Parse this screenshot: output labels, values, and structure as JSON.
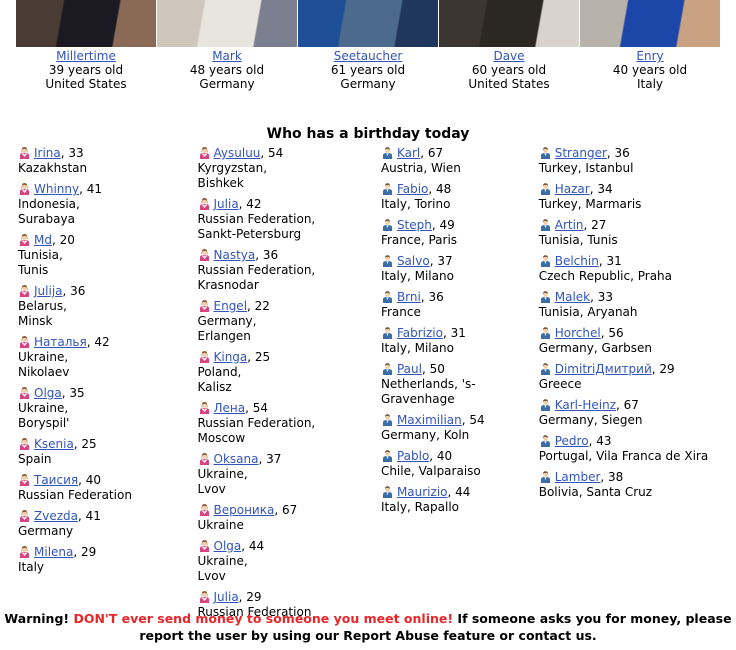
{
  "featured": {
    "members": [
      {
        "name": "Millertime",
        "age": "39 years old",
        "country": "United States",
        "photo_tone": [
          "#4a3b34",
          "#1b1a22",
          "#8a6a55"
        ]
      },
      {
        "name": "Mark",
        "age": "48 years old",
        "country": "Germany",
        "photo_tone": [
          "#cfc6bc",
          "#e8e4de",
          "#7b7f90"
        ]
      },
      {
        "name": "Seetaucher",
        "age": "61 years old",
        "country": "Germany",
        "photo_tone": [
          "#1e4f96",
          "#4b6a8d",
          "#21365c"
        ]
      },
      {
        "name": "Dave",
        "age": "60 years old",
        "country": "United States",
        "photo_tone": [
          "#3c3632",
          "#2b2723",
          "#d8d3cc"
        ]
      },
      {
        "name": "Enry",
        "age": "40 years old",
        "country": "Italy",
        "photo_tone": [
          "#b7b3aa",
          "#1c47a8",
          "#c9a283"
        ]
      }
    ]
  },
  "heading": "Who has a birthday today",
  "icons": {
    "female": "female-user-icon",
    "male": "male-user-icon"
  },
  "colors": {
    "link": "#3355bb",
    "warning_red": "#e8262a",
    "female_icon": "#d9437f",
    "male_icon": "#3a6ea5"
  },
  "columns": [
    {
      "gender": "female",
      "entries": [
        {
          "name": "Irina",
          "age": "33",
          "location": "Kazakhstan"
        },
        {
          "name": "Whinny",
          "age": "41",
          "location": "Indonesia,\nSurabaya"
        },
        {
          "name": "Md",
          "age": "20",
          "location": "Tunisia,\nTunis"
        },
        {
          "name": "Julija",
          "age": "36",
          "location": "Belarus,\nMinsk"
        },
        {
          "name": "Наталья",
          "age": "42",
          "location": "Ukraine,\nNikolaev"
        },
        {
          "name": "Olga",
          "age": "35",
          "location": "Ukraine,\nBoryspil'"
        },
        {
          "name": "Ksenia",
          "age": "25",
          "location": "Spain"
        },
        {
          "name": "Таисия",
          "age": "40",
          "location": "Russian Federation"
        },
        {
          "name": "Zvezda",
          "age": "41",
          "location": "Germany"
        },
        {
          "name": "Milena",
          "age": "29",
          "location": "Italy"
        }
      ]
    },
    {
      "gender": "female",
      "entries": [
        {
          "name": "Aysuluu",
          "age": "54",
          "location": "Kyrgyzstan,\nBishkek"
        },
        {
          "name": "Julia",
          "age": "42",
          "location": "Russian Federation,\nSankt-Petersburg"
        },
        {
          "name": "Nastya",
          "age": "36",
          "location": "Russian Federation,\nKrasnodar"
        },
        {
          "name": "Engel",
          "age": "22",
          "location": "Germany,\nErlangen"
        },
        {
          "name": "Kinga",
          "age": "25",
          "location": "Poland,\nKalisz"
        },
        {
          "name": "Лена",
          "age": "54",
          "location": "Russian Federation,\nMoscow"
        },
        {
          "name": "Oksana",
          "age": "37",
          "location": "Ukraine,\nLvov"
        },
        {
          "name": "Вероника",
          "age": "67",
          "location": "Ukraine"
        },
        {
          "name": "Olga",
          "age": "44",
          "location": "Ukraine,\nLvov"
        },
        {
          "name": "Julia",
          "age": "29",
          "location": "Russian Federation"
        }
      ]
    },
    {
      "gender": "male",
      "entries": [
        {
          "name": "Karl",
          "age": "67",
          "location": "Austria, Wien"
        },
        {
          "name": "Fabio",
          "age": "48",
          "location": "Italy, Torino"
        },
        {
          "name": "Steph",
          "age": "49",
          "location": "France, Paris"
        },
        {
          "name": "Salvo",
          "age": "37",
          "location": "Italy, Milano"
        },
        {
          "name": "Brni",
          "age": "36",
          "location": "France"
        },
        {
          "name": "Fabrizio",
          "age": "31",
          "location": "Italy, Milano"
        },
        {
          "name": "Paul",
          "age": "50",
          "location": "Netherlands, 's-Gravenhage"
        },
        {
          "name": "Maximilian",
          "age": "54",
          "location": "Germany, Koln"
        },
        {
          "name": "Pablo",
          "age": "40",
          "location": "Chile, Valparaiso"
        },
        {
          "name": "Maurizio",
          "age": "44",
          "location": "Italy, Rapallo"
        }
      ]
    },
    {
      "gender": "male",
      "entries": [
        {
          "name": "Stranger",
          "age": "36",
          "location": "Turkey, Istanbul"
        },
        {
          "name": "Hazar",
          "age": "34",
          "location": "Turkey, Marmaris"
        },
        {
          "name": "Artin",
          "age": "27",
          "location": "Tunisia, Tunis"
        },
        {
          "name": "Belchin",
          "age": "31",
          "location": "Czech Republic, Praha"
        },
        {
          "name": "Malek",
          "age": "33",
          "location": "Tunisia, Aryanah"
        },
        {
          "name": "Horchel",
          "age": "56",
          "location": "Germany, Garbsen"
        },
        {
          "name": "DimitriДмитрий",
          "age": "29",
          "location": "Greece"
        },
        {
          "name": "Karl-Heinz",
          "age": "67",
          "location": "Germany, Siegen"
        },
        {
          "name": "Pedro",
          "age": "43",
          "location": "Portugal, Vila Franca de Xira"
        },
        {
          "name": "Lamber",
          "age": "38",
          "location": "Bolivia, Santa Cruz"
        }
      ]
    }
  ],
  "warning": {
    "prefix": "Warning!",
    "red_text": "DON'T ever send money to someone you meet online!",
    "suffix": "If someone asks you for money, please report the user by using our Report Abuse feature or contact us."
  }
}
